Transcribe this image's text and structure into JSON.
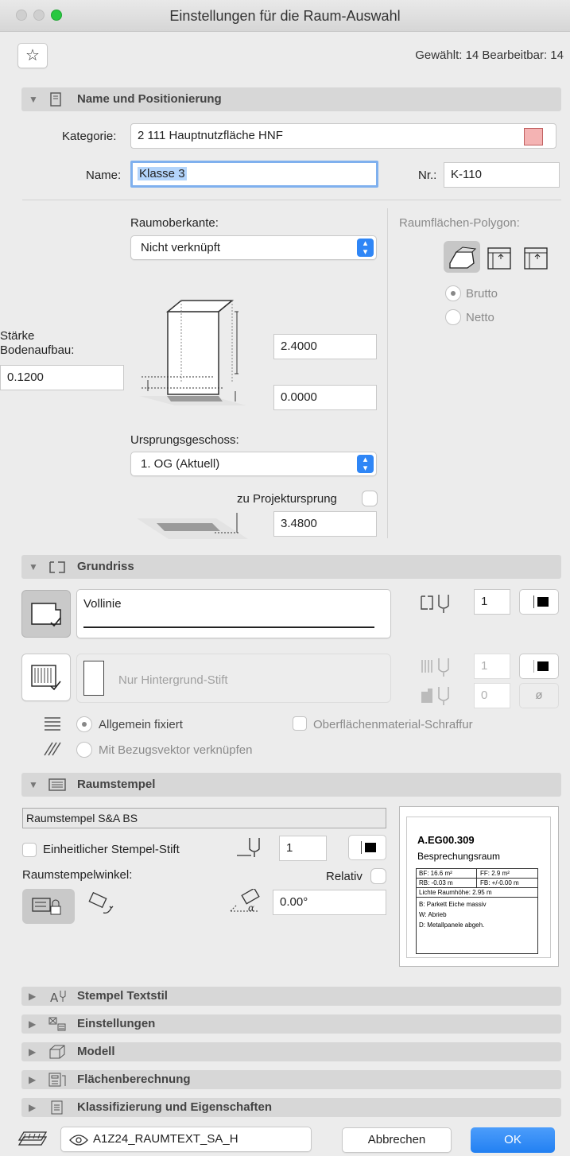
{
  "window": {
    "title": "Einstellungen für die Raum-Auswahl"
  },
  "header": {
    "selection_info": "Gewählt: 14 Bearbeitbar: 14"
  },
  "name_section": {
    "title": "Name und Positionierung",
    "category_label": "Kategorie:",
    "category_value": "2 111    Hauptnutzfläche HNF",
    "category_color": "#f4b3b3",
    "name_label": "Name:",
    "name_value": "Klasse 3",
    "nr_label": "Nr.:",
    "nr_value": "K-110"
  },
  "geometry": {
    "top_label": "Raumoberkante:",
    "top_value": "Nicht verknüpft",
    "floor_thickness_label_1": "Stärke",
    "floor_thickness_label_2": "Bodenaufbau:",
    "floor_thickness_value": "0.1200",
    "height_value": "2.4000",
    "offset_value": "0.0000",
    "origin_story_label": "Ursprungsgeschoss:",
    "origin_story_value": "1. OG (Aktuell)",
    "project_origin_label": "zu Projektursprung",
    "project_origin_value": "3.4800",
    "polygon_label": "Raumflächen-Polygon:",
    "polygon_opt1": "Brutto",
    "polygon_opt2": "Netto"
  },
  "grundriss": {
    "title": "Grundriss",
    "line_type": "Vollinie",
    "pen_value": "1",
    "hatch_label": "Nur Hintergrund-Stift",
    "hatch_pen_value": "1",
    "bg_pen_value": "0",
    "fixed_label": "Allgemein fixiert",
    "vector_label": "Mit Bezugsvektor verknüpfen",
    "surface_hatch_label": "Oberflächenmaterial-Schraffur"
  },
  "raumstempel": {
    "title": "Raumstempel",
    "stamp_name": "Raumstempel  S&A BS",
    "uniform_pen_label": "Einheitlicher Stempel-Stift",
    "uniform_pen_value": "1",
    "angle_label": "Raumstempelwinkel:",
    "relative_label": "Relativ",
    "angle_value": "0.00°",
    "preview": {
      "id": "A.EG00.309",
      "room": "Besprechungsraum",
      "bf": "BF: 16.6 m²",
      "ff": "FF: 2.9 m²",
      "rb": "RB: -0.03 m",
      "fb": "FB: +/-0.00 m",
      "lichte": "Lichte Raumhöhe: 2.95 m",
      "b": "B:  Parkett Eiche massiv",
      "w": "W: Abrieb",
      "d": "D:  Metallpanele abgeh."
    }
  },
  "collapsed_sections": [
    "Stempel Textstil",
    "Einstellungen",
    "Modell",
    "Flächenberechnung",
    "Klassifizierung und Eigenschaften"
  ],
  "footer": {
    "layer": "A1Z24_RAUMTEXT_SA_H",
    "cancel": "Abbrechen",
    "ok": "OK"
  }
}
